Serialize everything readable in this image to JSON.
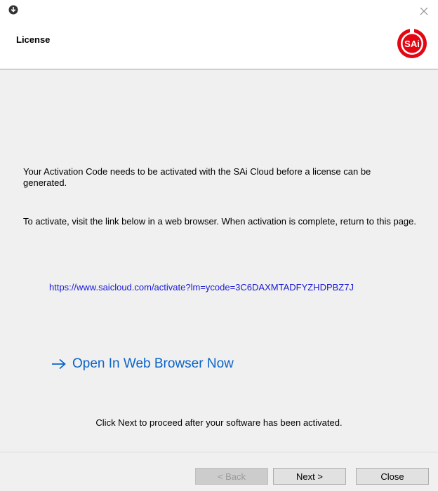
{
  "header": {
    "title": "License"
  },
  "content": {
    "para1": "Your Activation Code needs to be activated with the SAi Cloud before a license can be generated.",
    "para2": "To activate, visit the link below in a web browser.  When activation is complete, return to this page.",
    "activation_link": "https://www.saicloud.com/activate?lm=ycode=3C6DAXMTADFYZHDPBZ7J",
    "open_browser_label": "Open In Web Browser Now",
    "hint": "Click Next to proceed after your software has been activated."
  },
  "footer": {
    "back_label": "< Back",
    "next_label": "Next >",
    "close_label": "Close"
  },
  "brand": {
    "logo_text": "SAi",
    "accent_color": "#e30613",
    "link_color": "#1a1ad6",
    "action_color": "#0a64c8"
  }
}
